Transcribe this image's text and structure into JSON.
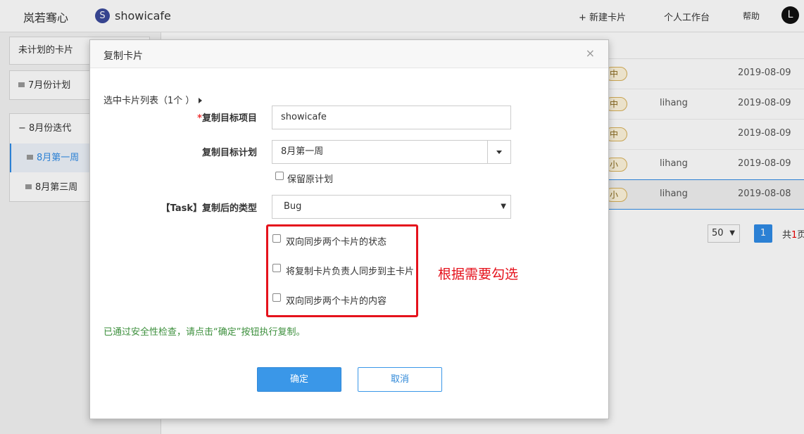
{
  "topbar": {
    "brand": "岚若骞心",
    "project_badge": "S",
    "project_name": "showicafe",
    "new_card": "+ 新建卡片",
    "workspace": "个人工作台",
    "help": "帮助",
    "avatar": "L"
  },
  "sidebar": {
    "unplanned": "未计划的卡片",
    "july_plan": "7月份计划",
    "aug_iteration": "8月份迭代",
    "week1": "8月第一周",
    "week3": "8月第三周"
  },
  "table": {
    "rows": [
      {
        "pill": "中",
        "owner": "",
        "date": "2019-08-09"
      },
      {
        "pill": "中",
        "owner": "lihang",
        "date": "2019-08-09"
      },
      {
        "pill": "中",
        "owner": "",
        "date": "2019-08-09"
      },
      {
        "pill": "小",
        "owner": "lihang",
        "date": "2019-08-09"
      },
      {
        "pill": "小",
        "owner": "lihang",
        "date": "2019-08-08"
      }
    ],
    "page_size": "50",
    "current_page": "1",
    "total_prefix": "共",
    "total_num": "1",
    "total_suffix": "页"
  },
  "modal": {
    "title": "复制卡片",
    "close": "×",
    "selected_list": "选中卡片列表（1个 ）",
    "target_project_label": "复制目标项目",
    "target_project_required": "*",
    "target_project_value": "showicafe",
    "target_plan_label": "复制目标计划",
    "target_plan_value": "8月第一周",
    "keep_plan_label": "保留原计划",
    "type_label": "【Task】复制后的类型",
    "type_value": "Bug",
    "sync_status": "双向同步两个卡片的状态",
    "sync_owner": "将复制卡片负责人同步到主卡片",
    "sync_content": "双向同步两个卡片的内容",
    "annotation": "根据需要勾选",
    "notice": "已通过安全性检查，请点击“确定”按钮执行复制。",
    "ok": "确定",
    "cancel": "取消"
  },
  "colors": {
    "accent": "#3a97e8",
    "annotation_red": "#e5121c",
    "notice_green": "#3c8f3c"
  }
}
